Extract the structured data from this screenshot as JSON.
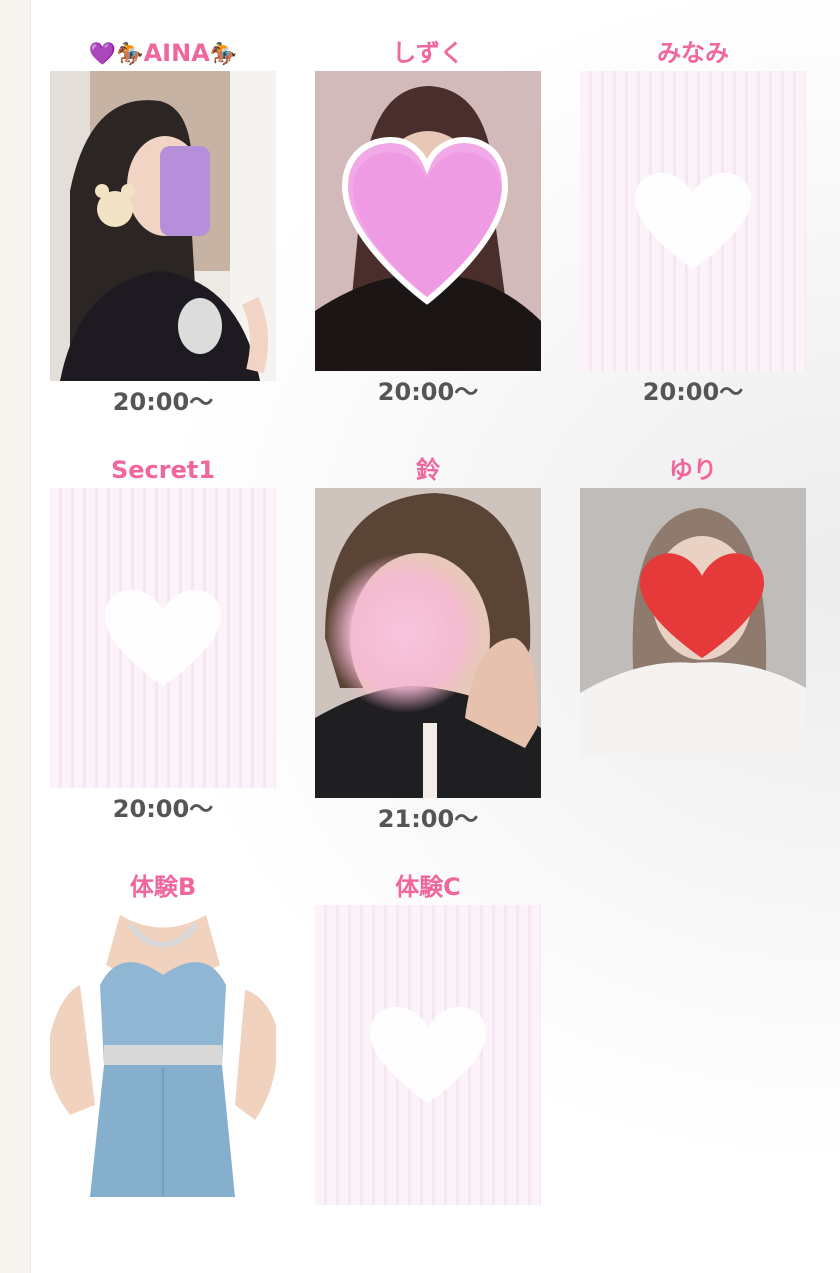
{
  "cast": [
    {
      "name_left_emoji": "💜🏇",
      "name": "AINA",
      "name_right_emoji": "🏇",
      "time": "20:00〜",
      "photo": "selfie-photo"
    },
    {
      "name": "しずく",
      "time": "20:00〜",
      "photo": "face-covered-pink-heart"
    },
    {
      "name": "みなみ",
      "time": "20:00〜",
      "photo": "no-image-placeholder"
    },
    {
      "name": "Secret1",
      "time": "20:00〜",
      "photo": "no-image-placeholder"
    },
    {
      "name": "鈴",
      "time": "21:00〜",
      "photo": "face-blurred-photo"
    },
    {
      "name": "ゆり",
      "time": "",
      "photo": "face-covered-red-heart"
    },
    {
      "name": "体験B",
      "time": "",
      "photo": "blue-dress-photo"
    },
    {
      "name": "体験C",
      "time": "",
      "photo": "no-image-placeholder"
    }
  ],
  "colors": {
    "name": "#f0679e",
    "time": "#555555",
    "placeholder_stripe": "#f4e7f2"
  }
}
